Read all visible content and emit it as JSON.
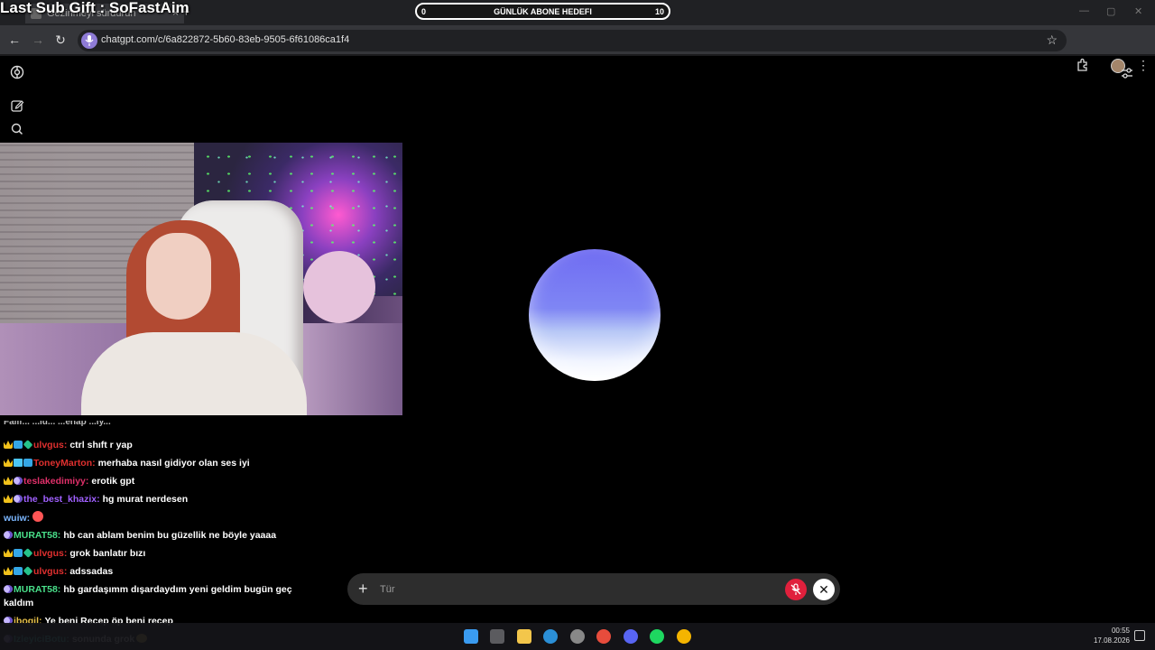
{
  "browser": {
    "tab_title": "Gezinmeyi sürdürün",
    "url": "chatgpt.com/c/6a822872-5b60-83eb-9505-6f61086ca1f4"
  },
  "stream_overlay": {
    "title": "Last Sub Gift : SoFastAim",
    "goal": {
      "current": "0",
      "label": "GÜNLÜK ABONE HEDEFI",
      "target": "10"
    }
  },
  "chat_cutoff_text": "Falif... ...lu... ...enap ...iy...",
  "chat": [
    {
      "badges": [
        "crown",
        "cube",
        "gem"
      ],
      "user": "ulvgus:",
      "color": "#e0302f",
      "text": "ctrl shıft r yap"
    },
    {
      "badges": [
        "crown",
        "grid",
        "cube"
      ],
      "user": "ToneyMarton:",
      "color": "#e0302f",
      "text": "merhaba nasıl gidiyor olan ses iyi"
    },
    {
      "badges": [
        "crown",
        "moon"
      ],
      "user": "teslakedimiyy:",
      "color": "#e0306a",
      "text": "erotik gpt"
    },
    {
      "badges": [
        "crown",
        "moon"
      ],
      "user": "the_best_khazix:",
      "color": "#a060ff",
      "text": "hg murat nerdesen"
    },
    {
      "badges": [],
      "user": "wuiw:",
      "color": "#7cb7ff",
      "text": "",
      "emote": true
    },
    {
      "badges": [
        "moon"
      ],
      "user": "MURAT58:",
      "color": "#49e08a",
      "text": "hb can ablam benim bu güzellik ne böyle yaaaa"
    },
    {
      "badges": [
        "crown",
        "cube",
        "gem"
      ],
      "user": "ulvgus:",
      "color": "#e0302f",
      "text": "grok banlatır bızı"
    },
    {
      "badges": [
        "crown",
        "cube",
        "gem"
      ],
      "user": "ulvgus:",
      "color": "#e0302f",
      "text": "adssadas"
    },
    {
      "badges": [
        "moon"
      ],
      "user": "MURAT58:",
      "color": "#49e08a",
      "text": "hb gardaşımm dışardaydım yeni geldim bugün geç kaldım"
    },
    {
      "badges": [
        "moon"
      ],
      "user": "ibogil:",
      "color": "#e8c24a",
      "text": "Ye beni Recep öp beni recep"
    },
    {
      "badges": [
        "moon"
      ],
      "user": "IzleyiciBotu:",
      "color": "#49e0d0",
      "text": "sonunda grok",
      "face": true
    }
  ],
  "composer": {
    "placeholder": "Tür"
  },
  "taskbar": {
    "time": "00:55",
    "date": "17.08.2026"
  },
  "icons": {
    "logo": "openai-logo-icon",
    "new_chat": "edit-icon",
    "search": "search-icon",
    "settings": "sliders-icon",
    "mic_off": "mic-off-icon",
    "close": "close-icon",
    "plus": "plus-icon"
  },
  "colors": {
    "accent_red": "#e0203c",
    "orb_top": "#6f6cf2",
    "orb_bottom": "#ffffff"
  }
}
